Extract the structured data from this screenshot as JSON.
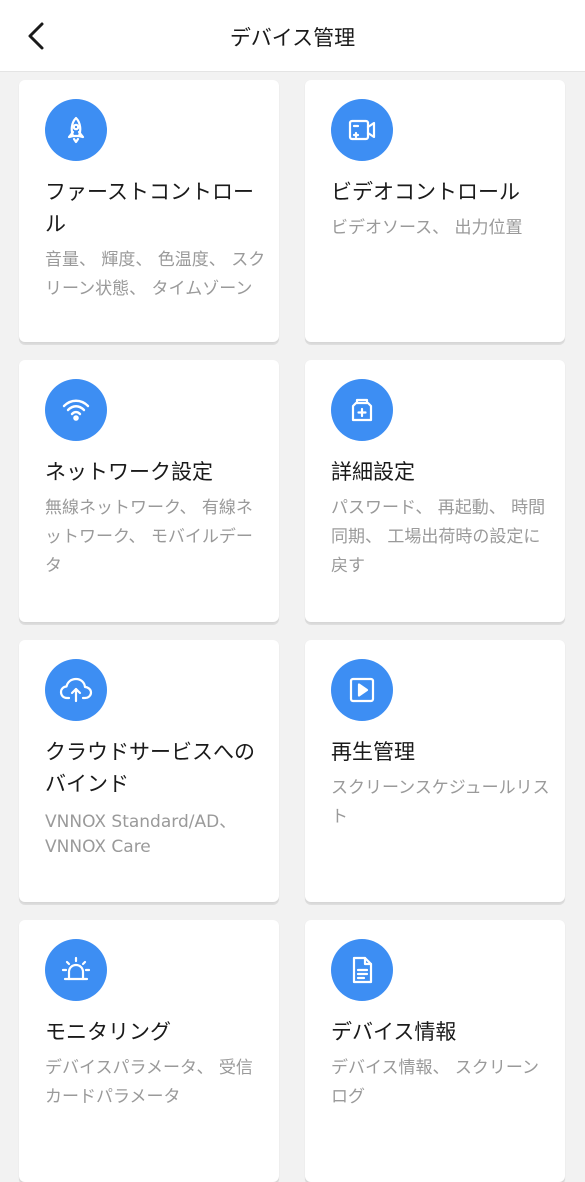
{
  "header": {
    "title": "デバイス管理",
    "back_icon": "chevron-left-icon"
  },
  "colors": {
    "accent": "#3d8ef3",
    "background": "#f2f2f2",
    "card": "#ffffff"
  },
  "cards": [
    {
      "title": "ファーストコントロール",
      "description": "音量、 輝度、 色温度、 スクリーン状態、 タイムゾーン",
      "icon": "rocket-icon"
    },
    {
      "title": "ビデオコントロール",
      "description": "ビデオソース、 出力位置",
      "icon": "video-camera-icon"
    },
    {
      "title": "ネットワーク設定",
      "description": "無線ネットワーク、 有線ネットワーク、 モバイルデータ",
      "icon": "wifi-icon"
    },
    {
      "title": "詳細設定",
      "description": "パスワード、 再起動、 時間同期、 工場出荷時の設定に戻す",
      "icon": "toolbox-icon"
    },
    {
      "title": "クラウドサービスへのバインド",
      "description": "VNNOX Standard/AD、 VNNOX Care",
      "icon": "cloud-upload-icon"
    },
    {
      "title": "再生管理",
      "description": "スクリーンスケジュールリスト",
      "icon": "play-icon"
    },
    {
      "title": "モニタリング",
      "description": "デバイスパラメータ、 受信カードパラメータ",
      "icon": "alarm-icon"
    },
    {
      "title": "デバイス情報",
      "description": "デバイス情報、 スクリーンログ",
      "icon": "document-icon"
    }
  ]
}
